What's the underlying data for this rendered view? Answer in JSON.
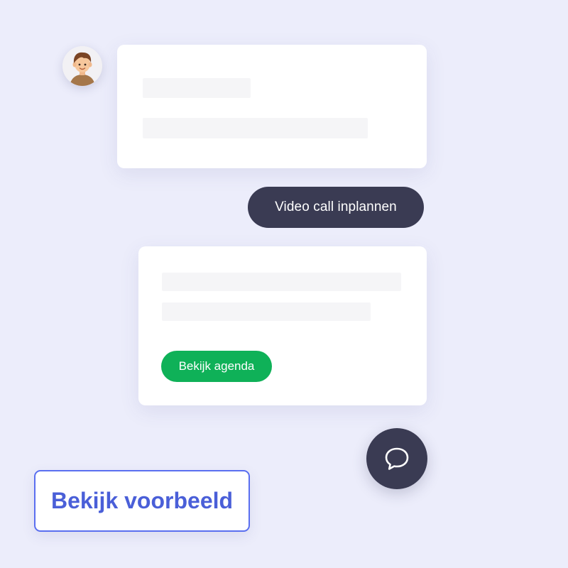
{
  "chat": {
    "avatar_icon": "boy-avatar-icon",
    "schedule_button_label": "Video call inplannen",
    "agenda_button_label": "Bekijk agenda",
    "fab_icon": "speech-bubble-icon"
  },
  "cta": {
    "label": "Bekijk voorbeeld"
  },
  "colors": {
    "background": "#ecedfb",
    "dark_pill": "#3a3b53",
    "green_button": "#0fb158",
    "cta_accent": "#5a6ff0"
  }
}
